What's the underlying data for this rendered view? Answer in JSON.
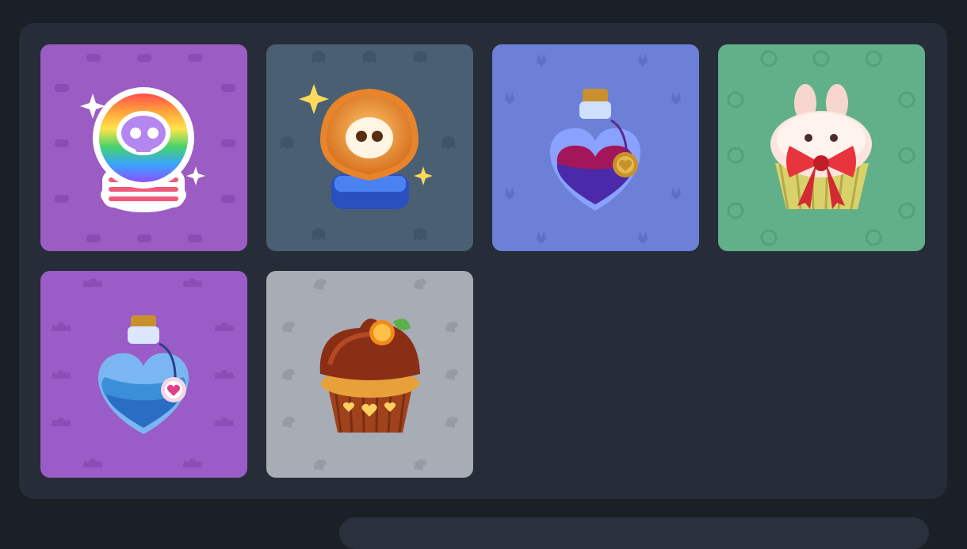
{
  "inventory": {
    "items": [
      {
        "icon": "rainbow-skull-crystal-ball-icon",
        "background": "#9b5cc4",
        "pattern": "#8a4cb4"
      },
      {
        "icon": "amber-skull-crystal-ball-icon",
        "background": "#4b5f72",
        "pattern": "#415366"
      },
      {
        "icon": "heart-potion-red-icon",
        "background": "#6c80d8",
        "pattern": "#5d70c8"
      },
      {
        "icon": "bunny-cupcake-bow-icon",
        "background": "#61b08a",
        "pattern": "#54a07b"
      },
      {
        "icon": "heart-potion-blue-icon",
        "background": "#9a5cc6",
        "pattern": "#8a4eb6"
      },
      {
        "icon": "orange-chocolate-cupcake-icon",
        "background": "#a8acb4",
        "pattern": "#979ba4"
      }
    ]
  }
}
